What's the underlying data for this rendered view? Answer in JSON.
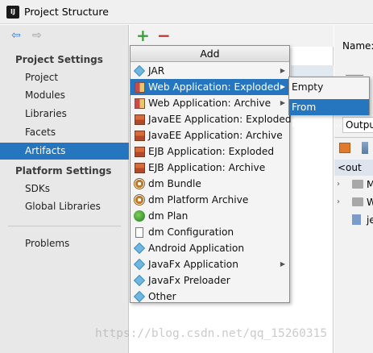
{
  "window": {
    "title": "Project Structure",
    "app_icon_text": "IJ"
  },
  "nav": {
    "back_icon": "arrow-left-icon",
    "forward_icon": "arrow-right-icon"
  },
  "sidebar": {
    "project_settings_title": "Project Settings",
    "project_settings_items": [
      {
        "label": "Project"
      },
      {
        "label": "Modules"
      },
      {
        "label": "Libraries"
      },
      {
        "label": "Facets"
      },
      {
        "label": "Artifacts",
        "selected": true
      }
    ],
    "platform_settings_title": "Platform Settings",
    "platform_settings_items": [
      {
        "label": "SDKs"
      },
      {
        "label": "Global Libraries"
      }
    ],
    "problems_label": "Problems"
  },
  "toolbar": {
    "add_symbol": "+",
    "remove_symbol": "−"
  },
  "add_menu": {
    "header": "Add",
    "items": [
      {
        "label": "JAR",
        "icon": "diamond",
        "submenu": true
      },
      {
        "label": "Web Application: Exploded",
        "icon": "web",
        "submenu": true,
        "selected": true
      },
      {
        "label": "Web Application: Archive",
        "icon": "web",
        "submenu": true
      },
      {
        "label": "JavaEE Application: Exploded",
        "icon": "ejb"
      },
      {
        "label": "JavaEE Application: Archive",
        "icon": "ejb"
      },
      {
        "label": "EJB Application: Exploded",
        "icon": "ejb"
      },
      {
        "label": "EJB Application: Archive",
        "icon": "ejb"
      },
      {
        "label": "dm Bundle",
        "icon": "dm"
      },
      {
        "label": "dm Platform Archive",
        "icon": "dm"
      },
      {
        "label": "dm Plan",
        "icon": "dmplan"
      },
      {
        "label": "dm Configuration",
        "icon": "doc"
      },
      {
        "label": "Android Application",
        "icon": "diamond"
      },
      {
        "label": "JavaFx Application",
        "icon": "diamond",
        "submenu": true
      },
      {
        "label": "JavaFx Preloader",
        "icon": "diamond"
      },
      {
        "label": "Other",
        "icon": "diamond"
      }
    ]
  },
  "sub_menu": {
    "items": [
      {
        "label": "Empty"
      },
      {
        "label": "From Modules...",
        "selected": true
      }
    ]
  },
  "right_panel": {
    "name_label": "Name:",
    "output_tab": "Outpu",
    "tree_root": "<out",
    "tree_rows": [
      {
        "chevron": "›",
        "text": "M"
      },
      {
        "chevron": "›",
        "text": "W"
      },
      {
        "chevron": "",
        "text": "je"
      }
    ]
  },
  "watermark": "https://blog.csdn.net/qq_15260315"
}
